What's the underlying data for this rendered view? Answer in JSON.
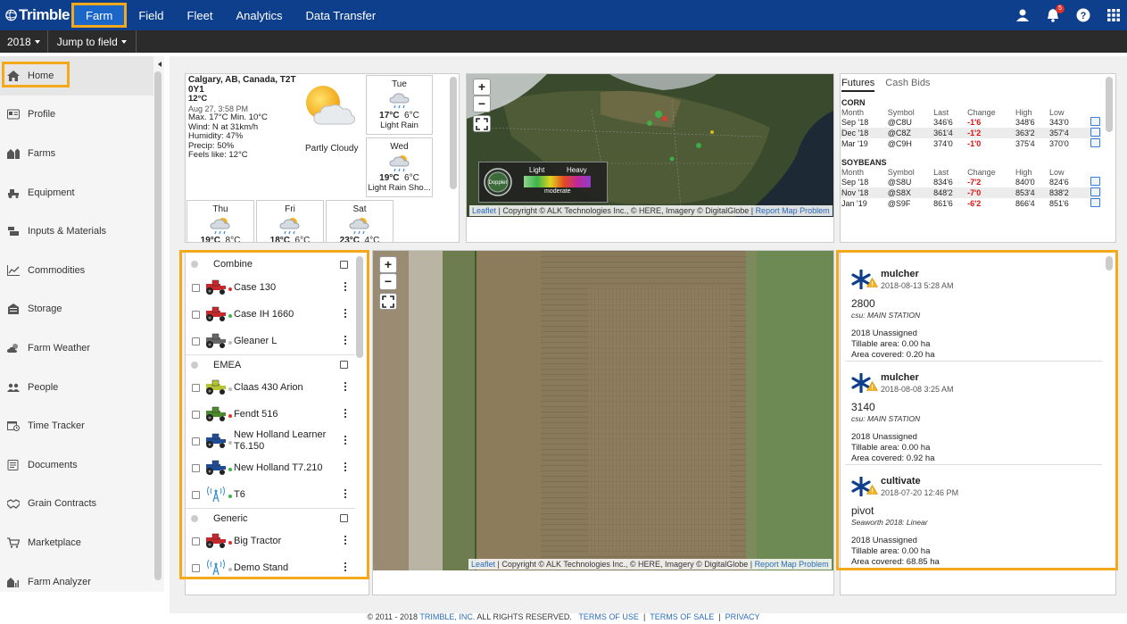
{
  "brand": {
    "name": "Trimble"
  },
  "topnav": {
    "items": [
      "Farm",
      "Field",
      "Fleet",
      "Analytics",
      "Data Transfer"
    ],
    "notification_count": "5"
  },
  "subbar": {
    "year": "2018",
    "jump": "Jump to field"
  },
  "sidebar": {
    "items": [
      "Home",
      "Profile",
      "Farms",
      "Equipment",
      "Inputs & Materials",
      "Commodities",
      "Storage",
      "Farm Weather",
      "People",
      "Time Tracker",
      "Documents",
      "Grain Contracts",
      "Marketplace",
      "Farm Analyzer"
    ]
  },
  "weather": {
    "location": "Calgary, AB, Canada, T2T 0Y1",
    "temp": "12°C",
    "datetime": "Aug 27, 3:58 PM",
    "maxmin": "Max. 17°C  Min. 10°C",
    "wind": "Wind: N at 31km/h",
    "humidity": "Humidity: 47%",
    "precip": "Precip: 50%",
    "feels": "Feels like: 12°C",
    "condition": "Partly Cloudy",
    "forecast": [
      {
        "day": "Tue",
        "hi": "17°C",
        "lo": "6°C",
        "desc": "Light Rain"
      },
      {
        "day": "Wed",
        "hi": "19°C",
        "lo": "6°C",
        "desc": "Light Rain Sho..."
      },
      {
        "day": "Thu",
        "hi": "19°C",
        "lo": "8°C",
        "desc": ""
      },
      {
        "day": "Fri",
        "hi": "18°C",
        "lo": "6°C",
        "desc": ""
      },
      {
        "day": "Sat",
        "hi": "23°C",
        "lo": "4°C",
        "desc": ""
      }
    ]
  },
  "radar": {
    "legend_light": "Light",
    "legend_heavy": "Heavy",
    "legend_moderate": "moderate",
    "doppler": "Doppler"
  },
  "map_attrib": {
    "leaflet": "Leaflet",
    "copyright": " | Copyright © ALK Technologies Inc., © HERE, Imagery © DigitalGlobe | ",
    "report": "Report Map Problem"
  },
  "zoom": {
    "in": "+",
    "out": "−"
  },
  "futures": {
    "tabs": [
      "Futures",
      "Cash Bids"
    ],
    "headers": [
      "Month",
      "Symbol",
      "Last",
      "Change",
      "High",
      "Low"
    ],
    "sections": [
      {
        "name": "CORN",
        "rows": [
          [
            "Sep '18",
            "@C8U",
            "346'6",
            "-1'6",
            "348'6",
            "343'0"
          ],
          [
            "Dec '18",
            "@C8Z",
            "361'4",
            "-1'2",
            "363'2",
            "357'4"
          ],
          [
            "Mar '19",
            "@C9H",
            "374'0",
            "-1'0",
            "375'4",
            "370'0"
          ]
        ]
      },
      {
        "name": "SOYBEANS",
        "rows": [
          [
            "Sep '18",
            "@S8U",
            "834'6",
            "-7'2",
            "840'0",
            "824'6"
          ],
          [
            "Nov '18",
            "@S8X",
            "848'2",
            "-7'0",
            "853'4",
            "838'2"
          ],
          [
            "Jan '19",
            "@S9F",
            "861'6",
            "-6'2",
            "866'4",
            "851'6"
          ]
        ]
      }
    ]
  },
  "fleet": {
    "groups": [
      {
        "name": "Combine",
        "units": [
          {
            "name": "Case 130",
            "status": "#e0312b",
            "color": "#c8282b"
          },
          {
            "name": "Case IH 1660",
            "status": "#3cb54a",
            "color": "#c8282b"
          },
          {
            "name": "Gleaner L",
            "status": "#bbbbbb",
            "color": "#666666"
          }
        ]
      },
      {
        "name": "EMEA",
        "units": [
          {
            "name": "Claas 430 Arion",
            "status": "#bbbbbb",
            "color": "#b5c531"
          },
          {
            "name": "Fendt 516",
            "status": "#e0312b",
            "color": "#4c8b2b"
          },
          {
            "name": "New Holland Learner T6.150",
            "status": "#bbbbbb",
            "color": "#1f4c99"
          },
          {
            "name": "New Holland T7.210",
            "status": "#3cb54a",
            "color": "#1f4c99"
          },
          {
            "name": "T6",
            "status": "#3cb54a",
            "color": "tower"
          }
        ]
      },
      {
        "name": "Generic",
        "units": [
          {
            "name": "Big Tractor",
            "status": "#e0312b",
            "color": "#c8282b"
          },
          {
            "name": "Demo Stand",
            "status": "#bbbbbb",
            "color": "tower"
          }
        ]
      }
    ]
  },
  "activities": [
    {
      "title": "mulcher",
      "date": "2018-08-13 5:28 AM",
      "name": "2800",
      "sub": "csu: MAIN STATION",
      "season": "2018 Unassigned",
      "tillable": "Tillable area: 0.00 ha",
      "covered": "Area covered: 0.20 ha"
    },
    {
      "title": "mulcher",
      "date": "2018-08-08 3:25 AM",
      "name": "3140",
      "sub": "csu: MAIN STATION",
      "season": "2018 Unassigned",
      "tillable": "Tillable area: 0.00 ha",
      "covered": "Area covered: 0.92 ha"
    },
    {
      "title": "cultivate",
      "date": "2018-07-20 12:46 PM",
      "name": "pivot",
      "sub": "Seaworth 2018: Linear",
      "season": "2018 Unassigned",
      "tillable": "Tillable area: 0.00 ha",
      "covered": "Area covered: 68.85 ha"
    }
  ],
  "footer": {
    "copy": "© 2011 - 2018 ",
    "company": "TRIMBLE, INC.",
    "rights": " ALL RIGHTS RESERVED.",
    "links": [
      "TERMS OF USE",
      "TERMS OF SALE",
      "PRIVACY"
    ]
  }
}
